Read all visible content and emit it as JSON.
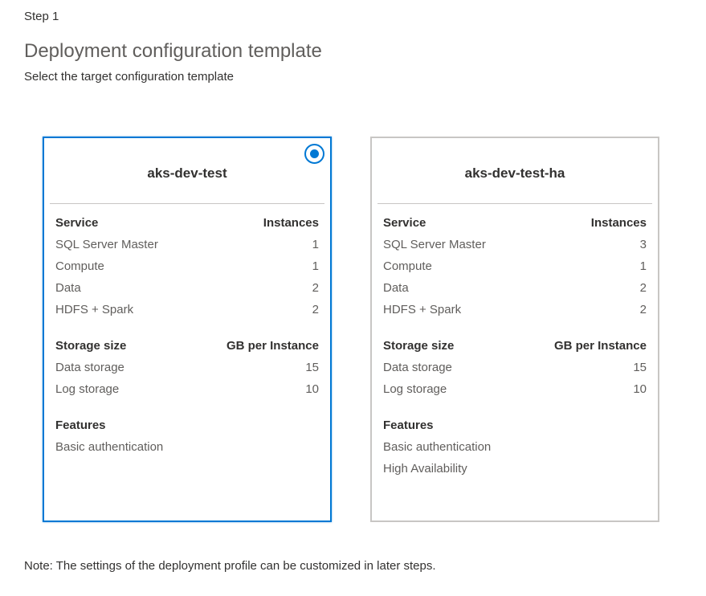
{
  "step_label": "Step 1",
  "title": "Deployment configuration template",
  "subtitle": "Select the target configuration template",
  "colors": {
    "accent": "#0078d4",
    "border": "#c8c6c4",
    "text": "#323130",
    "muted_text": "#605e5c"
  },
  "templates": [
    {
      "name": "aks-dev-test",
      "selected": true,
      "service_header": "Service",
      "instances_header": "Instances",
      "services": [
        {
          "name": "SQL Server Master",
          "instances": "1"
        },
        {
          "name": "Compute",
          "instances": "1"
        },
        {
          "name": "Data",
          "instances": "2"
        },
        {
          "name": "HDFS + Spark",
          "instances": "2"
        }
      ],
      "storage_header": "Storage size",
      "gb_header": "GB per Instance",
      "storage": [
        {
          "name": "Data storage",
          "size": "15"
        },
        {
          "name": "Log storage",
          "size": "10"
        }
      ],
      "features_header": "Features",
      "features": [
        "Basic authentication"
      ]
    },
    {
      "name": "aks-dev-test-ha",
      "selected": false,
      "service_header": "Service",
      "instances_header": "Instances",
      "services": [
        {
          "name": "SQL Server Master",
          "instances": "3"
        },
        {
          "name": "Compute",
          "instances": "1"
        },
        {
          "name": "Data",
          "instances": "2"
        },
        {
          "name": "HDFS + Spark",
          "instances": "2"
        }
      ],
      "storage_header": "Storage size",
      "gb_header": "GB per Instance",
      "storage": [
        {
          "name": "Data storage",
          "size": "15"
        },
        {
          "name": "Log storage",
          "size": "10"
        }
      ],
      "features_header": "Features",
      "features": [
        "Basic authentication",
        "High Availability"
      ]
    }
  ],
  "note": "Note: The settings of the deployment profile can be customized in later steps."
}
